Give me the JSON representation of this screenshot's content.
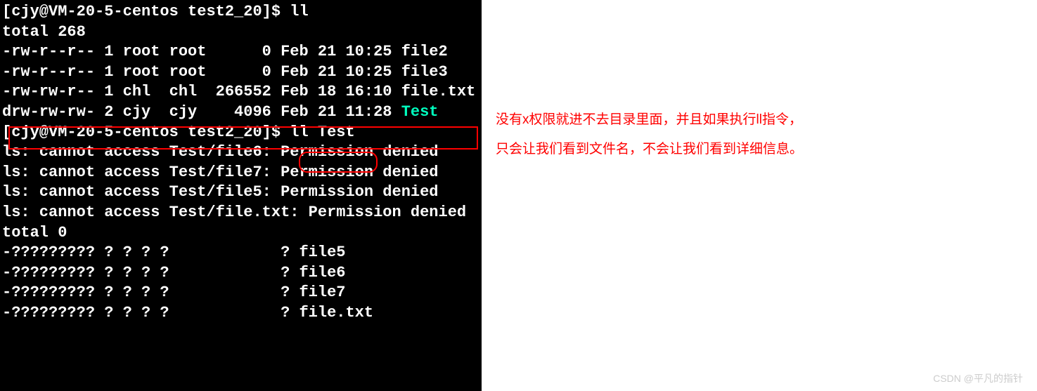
{
  "terminal": {
    "prompt1": "[cjy@VM-20-5-centos test2_20]$ ",
    "cmd1": "ll",
    "total1": "total 268",
    "files": [
      {
        "perms": "-rw-r--r--",
        "links": "1",
        "owner": "root",
        "group": "root",
        "size": "     0",
        "date": "Feb 21 10:25",
        "name": "file2"
      },
      {
        "perms": "-rw-r--r--",
        "links": "1",
        "owner": "root",
        "group": "root",
        "size": "     0",
        "date": "Feb 21 10:25",
        "name": "file3"
      },
      {
        "perms": "-rw-rw-r--",
        "links": "1",
        "owner": "chl ",
        "group": "chl ",
        "size": "266552",
        "date": "Feb 18 16:10",
        "name": "file.txt"
      },
      {
        "perms": "drw-rw-rw-",
        "links": "2",
        "owner": "cjy ",
        "group": "cjy ",
        "size": "  4096",
        "date": "Feb 21 11:28",
        "name": "Test",
        "dir": true
      }
    ],
    "prompt2": "[cjy@VM-20-5-centos test2_20]$ ",
    "cmd2": "ll Test",
    "errors": [
      "ls: cannot access Test/file6: Permission denied",
      "ls: cannot access Test/file7: Permission denied",
      "ls: cannot access Test/file5: Permission denied",
      "ls: cannot access Test/file.txt: Permission denied"
    ],
    "total2": "total 0",
    "denied_files": [
      {
        "perms": "-?????????",
        "rest": "? ? ? ?            ?",
        "name": "file5"
      },
      {
        "perms": "-?????????",
        "rest": "? ? ? ?            ?",
        "name": "file6"
      },
      {
        "perms": "-?????????",
        "rest": "? ? ? ?            ?",
        "name": "file7"
      },
      {
        "perms": "-?????????",
        "rest": "? ? ? ?            ?",
        "name": "file.txt"
      }
    ]
  },
  "annotation": {
    "line1": "没有x权限就进不去目录里面，并且如果执行ll指令，",
    "line2": "只会让我们看到文件名，不会让我们看到详细信息。"
  },
  "watermark": "CSDN @平凡的指针"
}
